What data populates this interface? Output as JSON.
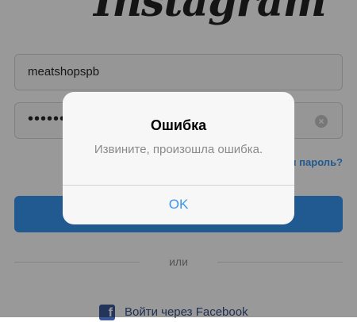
{
  "app": {
    "logo_text": "Instagram"
  },
  "login_form": {
    "username_value": "meatshopspb",
    "password_value": "••••••",
    "forgot_password_label": "Забыли пароль?"
  },
  "divider": {
    "or_label": "или"
  },
  "facebook": {
    "login_label": "Войти через Facebook",
    "icon": "facebook-icon"
  },
  "dialog": {
    "title": "Ошибка",
    "message": "Извините, произошла ошибка.",
    "ok_label": "OK"
  },
  "colors": {
    "accent": "#3897f0",
    "facebook": "#3b5998"
  }
}
